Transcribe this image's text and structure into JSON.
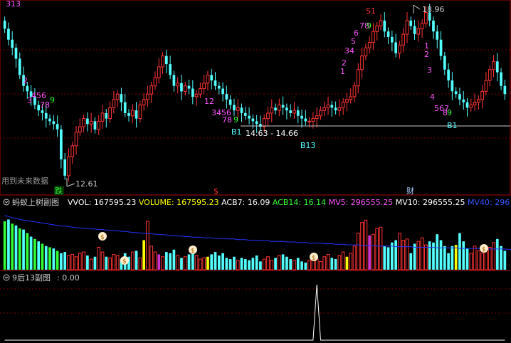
{
  "panels": {
    "main": {
      "label_topleft": "313",
      "note_left": "用到未来数据",
      "hline_label": "14.63 - 14.66",
      "max_label": "18.96",
      "min_label": "12.61",
      "marker_b1_left": "B1",
      "marker_b13": "B13",
      "marker_b1_right": "B1",
      "marker_s1": "S1",
      "bottom_tag_left": "跌",
      "bottom_tag_mid": "$",
      "bottom_tag_right": "财"
    },
    "volume": {
      "title": "蚂蚁上树副图",
      "fields": [
        {
          "text": "VVOL: 167595.23",
          "color": "#ffffff"
        },
        {
          "text": "VOLUME: 167595.23",
          "color": "#ffff00"
        },
        {
          "text": "ACB7: 16.09",
          "color": "#ffffff"
        },
        {
          "text": "ACB14: 16.14",
          "color": "#33ff33"
        },
        {
          "text": "MV5: 296555.25",
          "color": "#ff55ff"
        },
        {
          "text": "MV10: 296555.25",
          "color": "#ffffff"
        },
        {
          "text": "MV40: 296",
          "color": "#3355ff"
        }
      ]
    },
    "indicator": {
      "title": "9后13副图",
      "value": ": 0.00"
    }
  },
  "colors": {
    "up": "#ff3333",
    "down": "#54ffff",
    "purple": "#cc33cc",
    "yellow": "#ffff00",
    "green": "#33ff33",
    "mv_line": "#2233ff",
    "grid": "#800000",
    "panel_border": "#b00000"
  },
  "chart_data": {
    "type": "candlestick",
    "price_range": [
      12.4,
      19.2
    ],
    "close": [
      18.3,
      17.9,
      17.6,
      17.2,
      16.6,
      16.2,
      16.0,
      15.8,
      15.5,
      15.3,
      15.2,
      15.0,
      14.9,
      14.8,
      14.6,
      13.5,
      12.9,
      13.6,
      14.0,
      14.5,
      14.7,
      15.0,
      14.8,
      14.9,
      14.6,
      14.9,
      15.2,
      15.0,
      15.4,
      15.7,
      15.9,
      15.6,
      15.2,
      15.1,
      15.3,
      15.0,
      15.5,
      15.7,
      15.9,
      16.2,
      16.5,
      16.9,
      17.3,
      17.0,
      16.6,
      16.2,
      16.3,
      16.0,
      16.2,
      16.1,
      15.8,
      15.9,
      16.1,
      16.3,
      16.6,
      16.4,
      16.2,
      16.1,
      15.9,
      15.7,
      15.5,
      15.3,
      15.4,
      15.2,
      15.1,
      15.0,
      14.9,
      14.8,
      14.7,
      15.0,
      15.2,
      15.4,
      15.3,
      15.5,
      15.4,
      15.3,
      15.2,
      15.3,
      15.1,
      15.0,
      14.9,
      14.9,
      15.0,
      15.1,
      15.3,
      15.4,
      15.5,
      15.4,
      15.3,
      15.4,
      15.6,
      15.7,
      15.8,
      16.2,
      16.8,
      17.3,
      17.6,
      17.8,
      18.2,
      18.4,
      18.6,
      18.2,
      18.0,
      17.8,
      17.4,
      17.7,
      18.1,
      18.6,
      18.4,
      18.1,
      18.3,
      18.5,
      18.9,
      18.6,
      18.2,
      17.9,
      17.3,
      16.8,
      16.4,
      16.0,
      15.9,
      15.7,
      15.6,
      15.4,
      15.5,
      15.6,
      15.7,
      16.0,
      16.4,
      16.8,
      17.1,
      16.7,
      16.2,
      15.9
    ],
    "volume": [
      82,
      85,
      78,
      75,
      70,
      68,
      62,
      56,
      52,
      48,
      44,
      40,
      38,
      36,
      32,
      28,
      30,
      24,
      26,
      22,
      28,
      30,
      24,
      18,
      22,
      38,
      30,
      22,
      20,
      26,
      24,
      18,
      28,
      22,
      30,
      32,
      20,
      50,
      82,
      40,
      30,
      26,
      22,
      30,
      28,
      34,
      24,
      20,
      22,
      26,
      30,
      24,
      18,
      20,
      22,
      26,
      30,
      24,
      28,
      20,
      18,
      22,
      16,
      20,
      18,
      16,
      20,
      24,
      14,
      18,
      22,
      16,
      20,
      24,
      26,
      22,
      18,
      16,
      20,
      14,
      12,
      16,
      20,
      18,
      14,
      22,
      26,
      20,
      18,
      24,
      30,
      22,
      28,
      40,
      62,
      80,
      84,
      58,
      60,
      70,
      72,
      40,
      38,
      46,
      50,
      62,
      50,
      52,
      28,
      44,
      48,
      54,
      42,
      48,
      46,
      60,
      50,
      40,
      28,
      40,
      42,
      62,
      48,
      36,
      28,
      40,
      32,
      28,
      30,
      38,
      46,
      52,
      40,
      32,
      30,
      26
    ],
    "mv40": [
      92,
      90,
      88,
      87,
      85,
      84,
      83,
      82,
      81,
      80,
      79,
      78,
      77,
      76,
      75,
      74,
      74,
      73,
      72,
      71,
      71,
      70,
      70,
      69,
      69,
      68,
      68,
      67,
      67,
      66,
      66,
      65,
      65,
      64,
      63,
      63,
      62,
      62,
      61,
      61,
      60,
      60,
      59,
      59,
      58,
      58,
      57,
      57,
      56,
      56,
      55,
      55,
      55,
      54,
      54,
      54,
      53,
      53,
      53,
      52,
      52,
      52,
      51,
      51,
      51,
      50,
      50,
      50,
      49,
      49,
      49,
      48,
      48,
      48,
      48,
      47,
      47,
      47,
      46,
      46,
      46,
      45,
      45,
      45,
      45,
      44,
      44,
      44,
      43,
      43,
      43,
      42,
      42,
      42,
      42,
      41,
      41,
      41,
      41,
      40,
      40,
      40,
      40,
      40,
      39,
      39,
      39,
      39,
      39,
      38,
      38,
      38,
      38,
      38,
      38,
      37,
      37,
      37,
      37,
      37,
      37,
      36,
      36,
      36,
      36,
      36,
      36,
      35,
      35,
      35,
      35,
      35,
      35,
      35,
      34,
      34
    ],
    "indicator_peak_index": 83
  }
}
